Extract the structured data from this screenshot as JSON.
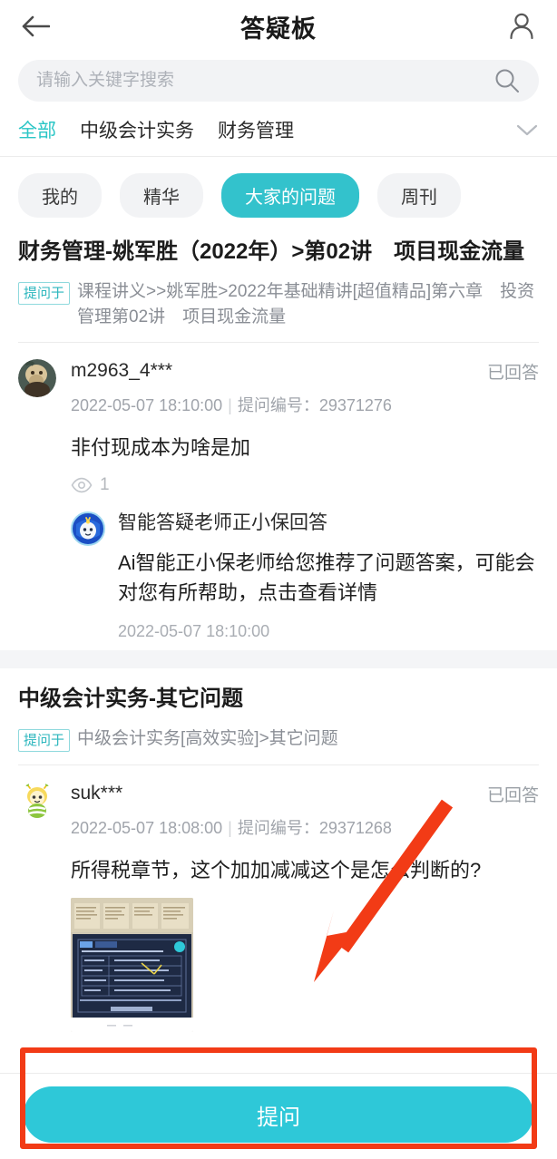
{
  "header": {
    "title": "答疑板",
    "back_icon": "arrow-left-icon",
    "user_icon": "user-icon"
  },
  "search": {
    "placeholder": "请输入关键字搜索",
    "value": "",
    "icon": "search-icon"
  },
  "categories": {
    "items": [
      {
        "label": "全部",
        "active": true
      },
      {
        "label": "中级会计实务",
        "active": false
      },
      {
        "label": "财务管理",
        "active": false
      }
    ],
    "expand_icon": "chevron-down-icon"
  },
  "filters": [
    {
      "label": "我的",
      "active": false
    },
    {
      "label": "精华",
      "active": false
    },
    {
      "label": "大家的问题",
      "active": true
    },
    {
      "label": "周刊",
      "active": false
    }
  ],
  "posts": [
    {
      "title": "财务管理-姚军胜（2022年）>第02讲　项目现金流量",
      "crumb_badge": "提问于",
      "crumb_text": "课程讲义>>姚军胜>2022年基础精讲[超值精品]第六章　投资管理第02讲　项目现金流量",
      "user": "m2963_4***",
      "status": "已回答",
      "time": "2022-05-07 18:10:00",
      "id_label": "提问编号：",
      "id_value": "29371276",
      "body": "非付现成本为啥是加",
      "views": "1",
      "views_icon": "eye-icon",
      "answer": {
        "title": "智能答疑老师正小保回答",
        "text": "Ai智能正小保老师给您推荐了问题答案，可能会对您有所帮助，点击查看详情",
        "time": "2022-05-07 18:10:00",
        "avatar_icon": "ai-bot-avatar"
      }
    },
    {
      "title": "中级会计实务-其它问题",
      "crumb_badge": "提问于",
      "crumb_text": "中级会计实务[高效实验]>其它问题",
      "user": "suk***",
      "status": "已回答",
      "time": "2022-05-07 18:08:00",
      "id_label": "提问编号：",
      "id_value": "29371268",
      "body": "所得税章节，这个加加减减这个是怎么判断的?",
      "thumbnail_name": "attached-screenshot-thumbnail"
    }
  ],
  "bottom": {
    "ask_label": "提问"
  },
  "annotations": {
    "highlight_color": "#f23b16",
    "arrow_name": "annotation-arrow",
    "rect_name": "annotation-rectangle"
  },
  "colors": {
    "accent": "#2ec8d8",
    "chip_active": "#33c2cc",
    "category_active": "#2bc6c6",
    "annotation": "#f23b16"
  }
}
